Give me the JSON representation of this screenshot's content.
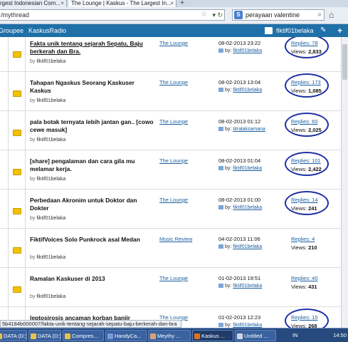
{
  "browser": {
    "tabs": [
      {
        "label": "rgest Indonesian Com...",
        "active": false
      },
      {
        "label": "The Lounge | Kaskus - The Largest In...",
        "active": true
      }
    ],
    "new_tab": "+",
    "url": "/mythread",
    "search_engine_icon": "S",
    "search_value": "perayaan valentine",
    "icons": [
      "star-icon",
      "dropdown-arrow-icon",
      "reload-icon",
      "search-icon",
      "home-icon"
    ]
  },
  "header": {
    "groupee": "Groupee",
    "radio": "KaskusRadio",
    "username": "fiktif01belaka",
    "icons": [
      "user-icon",
      "pencil-icon",
      "plus-icon"
    ]
  },
  "threads": [
    {
      "title": "Fakta unik tentang sejarah Sepatu, Baju berkerah dan Bra.",
      "author_prefix": "by",
      "author": "fiktif01belaka",
      "forum": "The Lounge",
      "date": "08-02-2013 23:22",
      "by_prefix": "by:",
      "last_by": "fiktif01belaka",
      "replies": "Replies: 78",
      "views_label": "Views:",
      "views": "2,833",
      "circled": true,
      "title_underlined": true
    },
    {
      "title": "Tahapan Ngaskus Seorang Kaskuser Kaskus",
      "author_prefix": "by",
      "author": "fiktif01belaka",
      "forum": "The Lounge",
      "date": "08-02-2013 13:04",
      "by_prefix": "by:",
      "last_by": "fiktif01belaka",
      "replies": "Replies: 173",
      "views_label": "Views:",
      "views": "1,085",
      "circled": true,
      "title_underlined": false
    },
    {
      "title": "pala botak ternyata lebih jantan gan.. [cowo cewe masuk]",
      "author_prefix": "by",
      "author": "fiktif01belaka",
      "forum": "The Lounge",
      "date": "08-02-2013 01:12",
      "by_prefix": "by:",
      "last_by": "titralaksamana",
      "replies": "Replies: 60",
      "views_label": "Views:",
      "views": "2,025",
      "circled": true,
      "title_underlined": false
    },
    {
      "title": "[share] pengalaman dan cara gila mu melamar kerja.",
      "author_prefix": "by",
      "author": "fiktif01belaka",
      "forum": "The Lounge",
      "date": "08-02-2013 01:04",
      "by_prefix": "by:",
      "last_by": "fiktif01belaka",
      "replies": "Replies: 101",
      "views_label": "Views:",
      "views": "2,422",
      "circled": true,
      "title_underlined": false
    },
    {
      "title": "Perbedaan Akronim untuk Doktor dan Dokter",
      "author_prefix": "by",
      "author": "fiktif01belaka",
      "forum": "The Lounge",
      "date": "08-02-2013 01:00",
      "by_prefix": "by:",
      "last_by": "fiktif01belaka",
      "replies": "Replies: 14",
      "views_label": "Views:",
      "views": "241",
      "circled": true,
      "title_underlined": false
    },
    {
      "title": "FiktifVoices Solo Punkrock asal Medan",
      "author_prefix": "by",
      "author": "fiktif01belaka",
      "forum": "Music Review",
      "date": "04-02-2013 11:06",
      "by_prefix": "by:",
      "last_by": "fiktif01belaka",
      "replies": "Replies: 4",
      "views_label": "Views:",
      "views": "210",
      "circled": false,
      "title_underlined": false
    },
    {
      "title": "Ramalan Kaskuser di 2013",
      "author_prefix": "by",
      "author": "fiktif01belaka",
      "forum": "The Lounge",
      "date": "01-02-2013 19:51",
      "by_prefix": "by:",
      "last_by": "fiktif01belaka",
      "replies": "Replies: 40",
      "views_label": "Views:",
      "views": "431",
      "circled": false,
      "title_underlined": false
    },
    {
      "title": "leptosirosis ancaman korban banjir",
      "author_prefix": "by",
      "author": "fiktif01belaka",
      "forum": "The Lounge",
      "date": "01-02-2013 12:23",
      "by_prefix": "by:",
      "last_by": "fiktif01belaka",
      "replies": "Replies: 15",
      "views_label": "Views:",
      "views": "268",
      "circled": true,
      "title_underlined": false
    }
  ],
  "status_url": "5b4184b000007/fakta-unik-tentang-sejarah-sepatu-baju-berkerah-dan-bra",
  "taskbar": {
    "tasks": [
      {
        "label": "DATA (D:)",
        "icon_color": "#e6c24a"
      },
      {
        "label": "DATA (D:)",
        "icon_color": "#e6c24a"
      },
      {
        "label": "Compres...",
        "icon_color": "#e6c24a"
      },
      {
        "label": "HandyCa...",
        "icon_color": "#7a9ad6"
      },
      {
        "label": "Meythy ...",
        "icon_color": "#d6a37a"
      },
      {
        "label": "Kaskus ...",
        "icon_color": "#e0701a"
      },
      {
        "label": "Untitled ...",
        "icon_color": "#cfd6e0"
      }
    ],
    "lang": "IN",
    "clock": "14:50"
  },
  "colors": {
    "header_blue": "#1f6fa8",
    "link_blue": "#1a5fa0",
    "folder_yellow": "#f2c200",
    "circle_ink": "#1c2fa4",
    "taskbar": "#274a7e"
  }
}
